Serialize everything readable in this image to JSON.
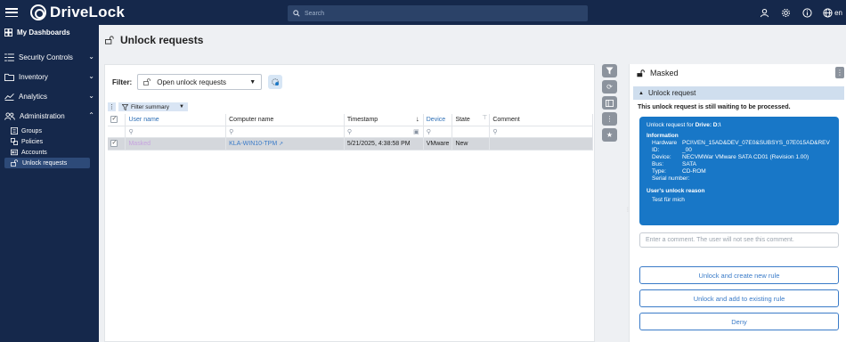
{
  "app": {
    "brand": "DriveLock",
    "search_placeholder": "Search",
    "lang": "en"
  },
  "sidebar": {
    "dashboards": "My Dashboards",
    "items": [
      {
        "label": "Security Controls"
      },
      {
        "label": "Inventory"
      },
      {
        "label": "Analytics"
      },
      {
        "label": "Administration"
      }
    ],
    "sub_items": [
      {
        "label": "Groups"
      },
      {
        "label": "Policies"
      },
      {
        "label": "Accounts"
      },
      {
        "label": "Unlock requests"
      }
    ]
  },
  "page": {
    "title": "Unlock requests"
  },
  "filter": {
    "label": "Filter:",
    "value": "Open unlock requests",
    "summary": "Filter summary"
  },
  "table": {
    "headers": [
      "User name",
      "Computer name",
      "Timestamp",
      "Device",
      "State",
      "Comment"
    ],
    "rows": [
      {
        "user": "Masked",
        "computer": "KLA-WIN10-TPM",
        "timestamp": "5/21/2025, 4:38:58 PM",
        "device": "VMware",
        "state": "New",
        "comment": ""
      }
    ]
  },
  "detail": {
    "user": "Masked",
    "section": "Unlock request",
    "status": "This unlock request is still waiting to be processed.",
    "card": {
      "title_prefix": "Unlock request for ",
      "title_drive": "Drive: D:\\",
      "info_label": "Information",
      "hw_label": "Hardware ID:",
      "hw_value": "PCI\\VEN_15AD&DEV_07E0&SUBSYS_07E015AD&REV_00",
      "device_label": "Device:",
      "device_value": "NECVMWar VMware SATA CD01 (Revision 1.00)",
      "bus_label": "Bus:",
      "bus_value": "SATA",
      "type_label": "Type:",
      "type_value": "CD-ROM",
      "serial_label": "Serial number:",
      "serial_value": "",
      "reason_label": "User's unlock reason",
      "reason_value": "Test für mich"
    },
    "comment_placeholder": "Enter a comment. The user will not see this comment.",
    "buttons": {
      "unlock_new": "Unlock and create new rule",
      "unlock_existing": "Unlock and add to existing rule",
      "deny": "Deny"
    }
  }
}
